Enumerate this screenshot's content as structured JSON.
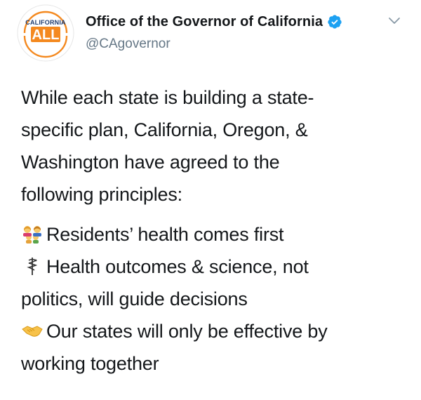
{
  "account": {
    "display_name": "Office of the Governor of California",
    "handle": "@CAgovernor",
    "verified": true,
    "avatar_logo": {
      "top_text": "CALIFORNIA",
      "main_text": "ALL"
    }
  },
  "tweet": {
    "intro_lines": [
      "While each state is building a state-",
      "specific plan, California, Oregon, &",
      "Washington have agreed to the",
      "following principles:"
    ],
    "principles": [
      {
        "icon": "family-emoji-icon",
        "lines": [
          "Residents’ health comes first"
        ]
      },
      {
        "icon": "staff-of-aesculapius-icon",
        "lines": [
          "Health outcomes & science, not",
          "politics, will guide decisions"
        ]
      },
      {
        "icon": "handshake-emoji-icon",
        "lines": [
          "Our states will only be effective by",
          "working together"
        ]
      }
    ]
  },
  "colors": {
    "text": "#14171a",
    "secondary_text": "#657786",
    "verified_blue": "#1da1f2",
    "logo_orange": "#f4891f",
    "logo_navy": "#1f3c6e"
  }
}
